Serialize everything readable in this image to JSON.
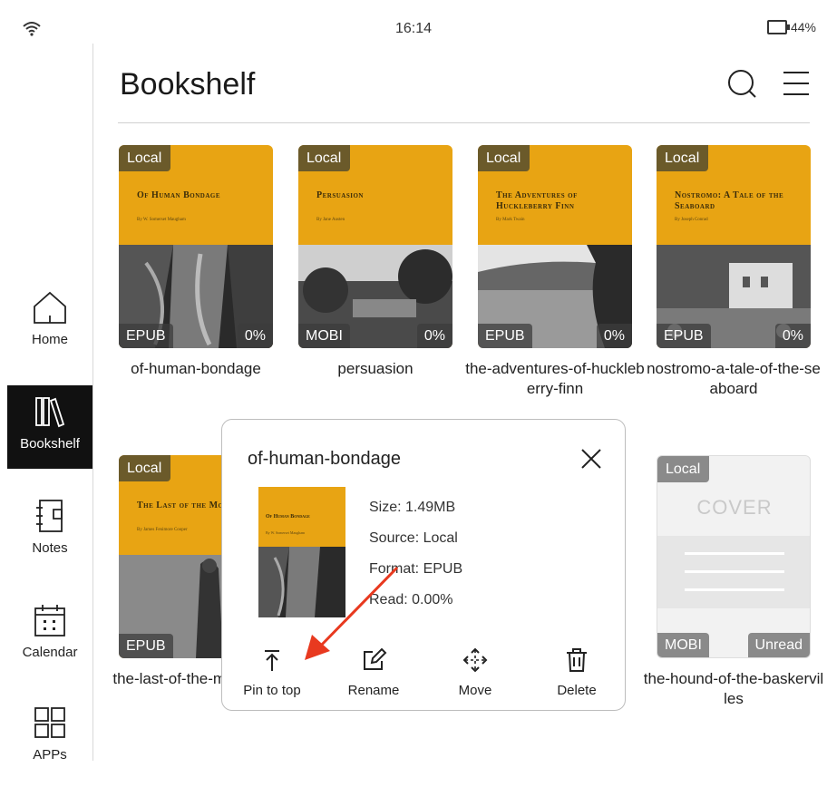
{
  "status": {
    "time": "16:14",
    "battery": "44%"
  },
  "sidebar": {
    "items": [
      {
        "label": "Home",
        "icon": "home-icon",
        "active": false
      },
      {
        "label": "Bookshelf",
        "icon": "bookshelf-icon",
        "active": true
      },
      {
        "label": "Notes",
        "icon": "notes-icon",
        "active": false
      },
      {
        "label": "Calendar",
        "icon": "calendar-icon",
        "active": false
      },
      {
        "label": "APPs",
        "icon": "apps-icon",
        "active": false
      }
    ]
  },
  "header": {
    "title": "Bookshelf",
    "search_icon": "search-icon",
    "menu_icon": "menu-icon"
  },
  "books": [
    {
      "name": "of-human-bondage",
      "source": "Local",
      "format": "EPUB",
      "progress": "0%",
      "cover_title": "Of Human Bondage",
      "cover_author": "By W. Somerset Maugham"
    },
    {
      "name": "persuasion",
      "source": "Local",
      "format": "MOBI",
      "progress": "0%",
      "cover_title": "Persuasion",
      "cover_author": "By Jane Austen"
    },
    {
      "name": "the-adventures-of-huckleberry-finn",
      "source": "Local",
      "format": "EPUB",
      "progress": "0%",
      "cover_title": "The Adventures of Huckleberry Finn",
      "cover_author": "By Mark Twain"
    },
    {
      "name": "nostromo-a-tale-of-the-seaboard",
      "source": "Local",
      "format": "EPUB",
      "progress": "0%",
      "cover_title": "Nostromo: A Tale of the Seaboard",
      "cover_author": "By Joseph Conrad"
    },
    {
      "name": "the-last-of-the-mohicans",
      "source": "Local",
      "format": "EPUB",
      "progress": "",
      "cover_title": "The Last of the Mohicans",
      "cover_author": "By James Fenimore Cooper"
    },
    {
      "name": "the-hound-of-the-baskervilles",
      "source": "Local",
      "format": "MOBI",
      "progress": "Unread",
      "cover_title": "COVER",
      "cover_author": ""
    }
  ],
  "popup": {
    "title": "of-human-bondage",
    "size": "Size: 1.49MB",
    "source": "Source: Local",
    "format": "Format: EPUB",
    "read": "Read: 0.00%",
    "actions": [
      {
        "label": "Pin to top",
        "icon": "pin-to-top-icon"
      },
      {
        "label": "Rename",
        "icon": "rename-icon"
      },
      {
        "label": "Move",
        "icon": "move-icon"
      },
      {
        "label": "Delete",
        "icon": "delete-icon"
      }
    ]
  },
  "colors": {
    "cover_yellow": "#e8a413",
    "badge_brown": "#6b5a2a",
    "active_nav": "#111111",
    "arrow_red": "#e8391f"
  }
}
